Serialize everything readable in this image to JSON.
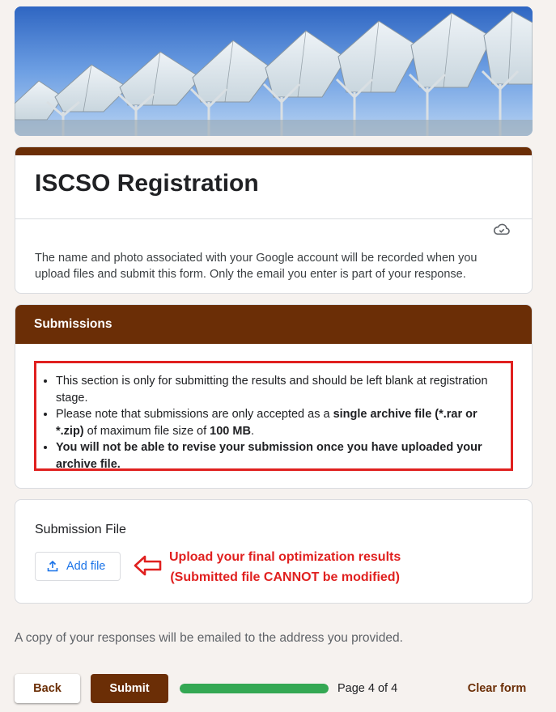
{
  "form": {
    "title": "ISCSO Registration",
    "account_note": "The name and photo associated with your Google account will be recorded when you upload files and submit this form. Only the email you enter is part of your response.",
    "cloud_icon": "cloud-check-icon"
  },
  "section": {
    "header": "Submissions",
    "bullet1": "This section is only for submitting the results and should be left blank at registration stage.",
    "bullet2_pre": "Please note that submissions are only accepted as a ",
    "bullet2_bold1": "single archive file (*.rar or *.zip)",
    "bullet2_mid": " of maximum file size of ",
    "bullet2_bold2": "100 MB",
    "bullet2_post": ".",
    "bullet3": "You will not be able to revise your submission once you have uploaded your archive file."
  },
  "file_question": {
    "label": "Submission File",
    "add_button": "Add file",
    "annotation_line1": "Upload your final optimization results",
    "annotation_line2": "(Submitted file CANNOT be modified)"
  },
  "footer_note": "A copy of your responses will be emailed to the address you provided.",
  "actions": {
    "back": "Back",
    "submit": "Submit",
    "page_indicator": "Page 4 of 4",
    "progress_fraction": 1.0,
    "clear": "Clear form"
  },
  "colors": {
    "theme": "#6b2e06",
    "annotation_red": "#e0201f",
    "progress_green": "#34a853",
    "link_blue": "#1a73e8"
  }
}
